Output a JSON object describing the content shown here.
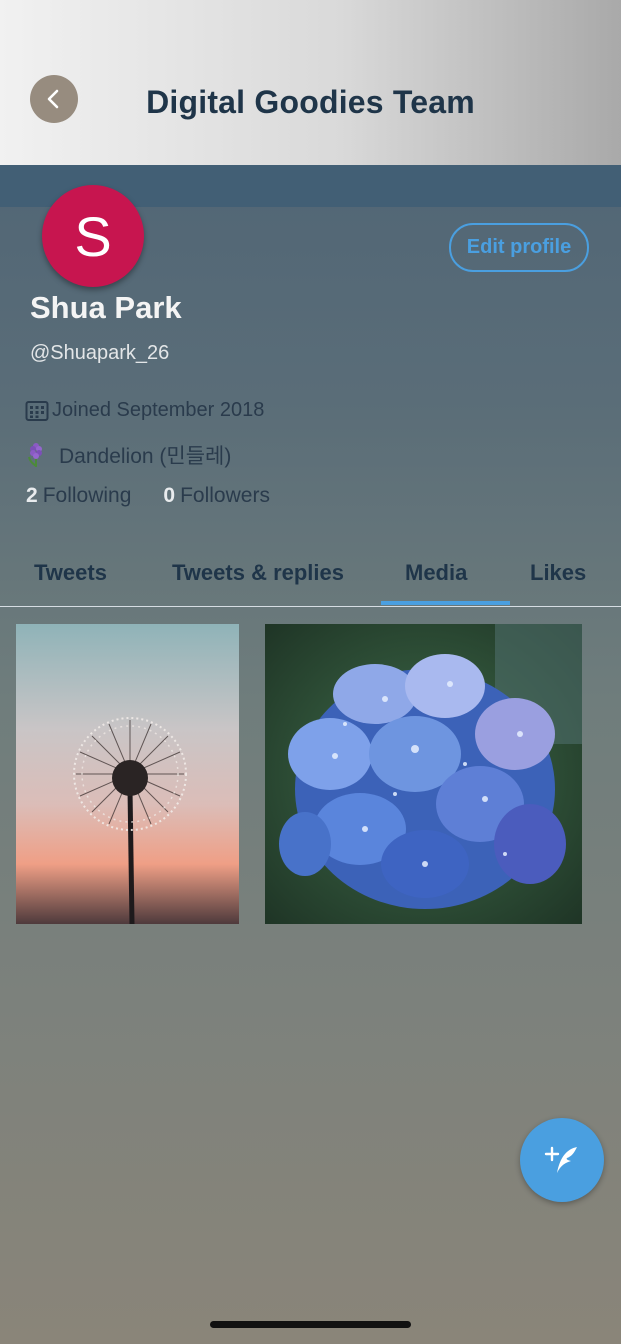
{
  "header": {
    "title": "Digital Goodies Team",
    "back_icon": "chevron-left-icon"
  },
  "profile": {
    "avatar_letter": "S",
    "avatar_color": "#c7154f",
    "name": "Shua Park",
    "handle": "@Shuapark_26",
    "edit_label": "Edit profile",
    "joined": "Joined September 2018",
    "joined_icon": "calendar-icon",
    "bio_icon": "hyacinth-flower-icon",
    "bio": "Dandelion (민들레)",
    "following_count": "2",
    "following_label": "Following",
    "followers_count": "0",
    "followers_label": "Followers"
  },
  "tabs": [
    {
      "label": "Tweets",
      "active": false
    },
    {
      "label": "Tweets & replies",
      "active": false
    },
    {
      "label": "Media",
      "active": true
    },
    {
      "label": "Likes",
      "active": false
    }
  ],
  "media": [
    {
      "subject": "dandelion at sunset"
    },
    {
      "subject": "blue hydrangea with water drops"
    }
  ],
  "fab": {
    "icon": "compose-tweet-icon"
  },
  "colors": {
    "accent": "#4a9fe0",
    "title": "#1f3549"
  }
}
